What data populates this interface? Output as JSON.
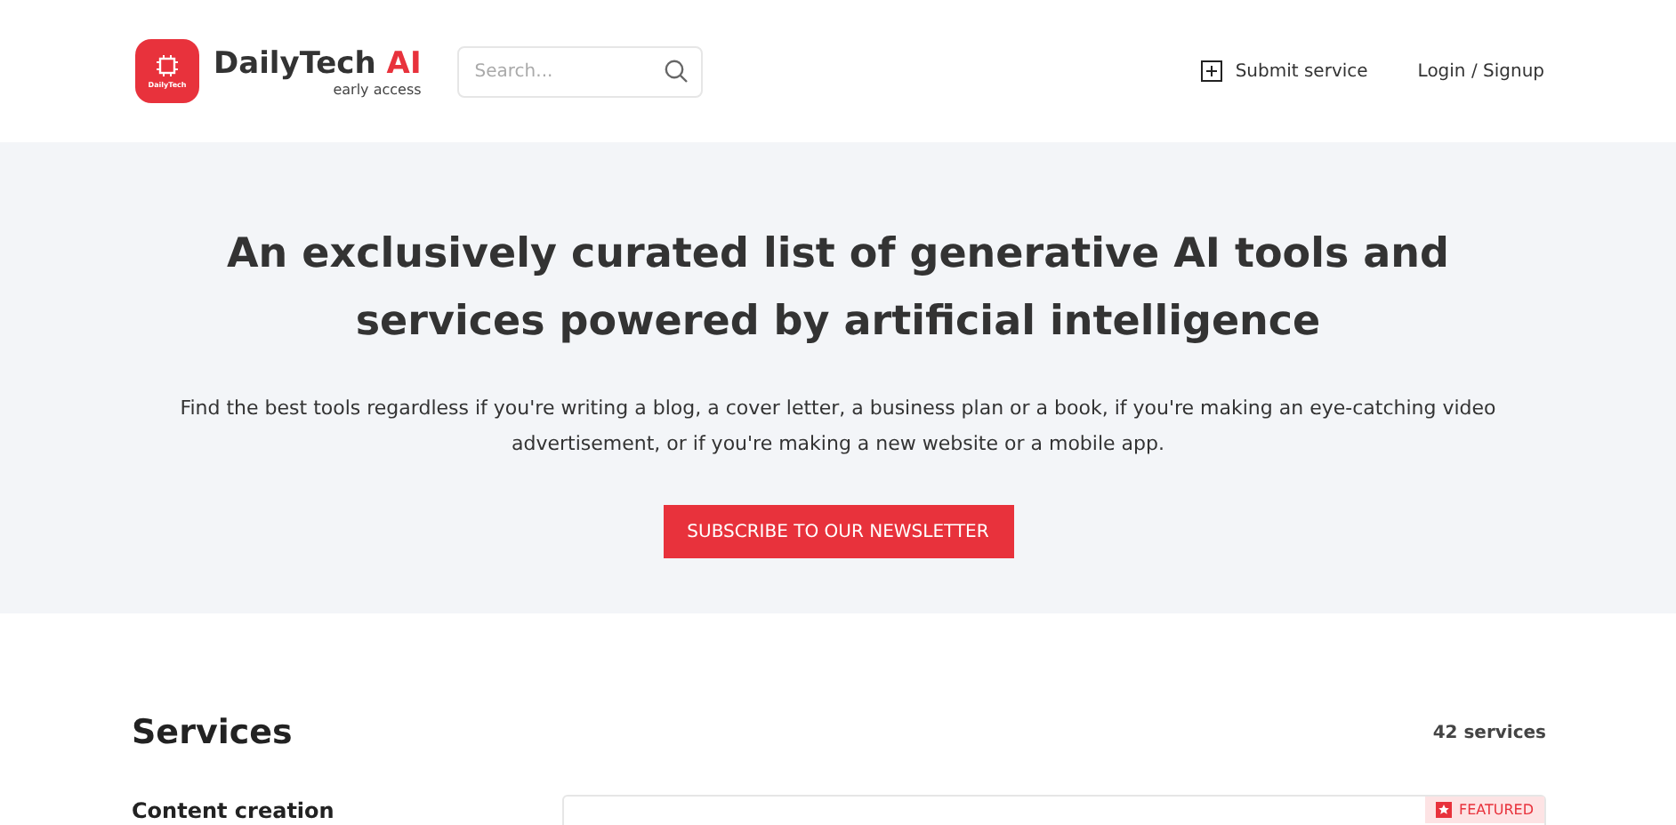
{
  "header": {
    "logo_text": "DailyTech",
    "brand": "DailyTech",
    "brand_accent": "AI",
    "tagline": "early access",
    "search": {
      "placeholder": "Search..."
    },
    "nav": [
      {
        "kind": "icon",
        "label": "Submit service"
      },
      {
        "kind": "plain",
        "label": "Login / Signup"
      }
    ]
  },
  "hero": {
    "title": "An exclusively curated list of generative AI tools and services powered by artificial intelligence",
    "text": "Find the best tools regardless if you're writing a blog, a cover letter, a business plan or a book, if you're making an eye-catching video advertisement, or if you're making a new website or a mobile app.",
    "button": "SUBSCRIBE TO OUR NEWSLETTER"
  },
  "services": {
    "title": "Services",
    "count": "42 services",
    "category": "Content creation",
    "card": {
      "badge": "FEATURED"
    }
  }
}
